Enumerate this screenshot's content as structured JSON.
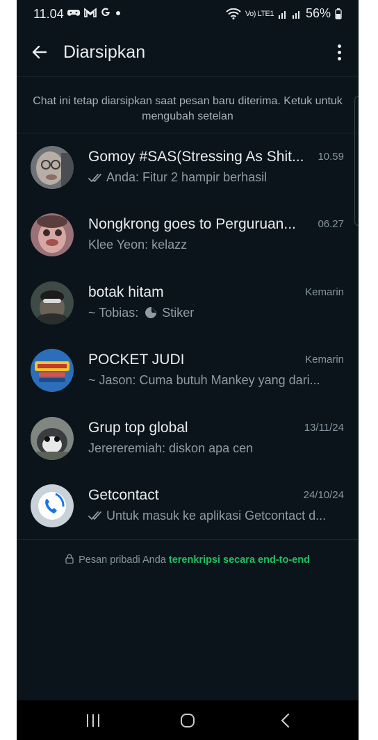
{
  "status_bar": {
    "time": "11.04",
    "notification_icons": [
      "game-controller-icon",
      "gmail-icon",
      "google-icon",
      "dot-icon"
    ],
    "network_label": "Vo) LTE1",
    "battery": "56%"
  },
  "header": {
    "title": "Diarsipkan",
    "back_icon": "arrow-left-icon",
    "menu_icon": "more-vertical-icon"
  },
  "info_text": "Chat ini tetap diarsipkan saat pesan baru diterima. Ketuk untuk mengubah setelan",
  "chats": [
    {
      "name": "Gomoy #SAS(Stressing As Shit...",
      "time": "10.59",
      "preview": "Anda: Fitur 2 hampir berhasil",
      "read_ticks": true,
      "avatar_color": "#7a8088"
    },
    {
      "name": "Nongkrong goes to Perguruan...",
      "time": "06.27",
      "preview": "Klee Yeon: kelazz",
      "read_ticks": false,
      "avatar_color": "#b9868a"
    },
    {
      "name": "botak hitam",
      "time": "Kemarin",
      "preview_prefix": "~ Tobias:",
      "preview": "Stiker",
      "sticker_icon": true,
      "read_ticks": false,
      "avatar_color": "#4a5550"
    },
    {
      "name": "POCKET JUDI",
      "time": "Kemarin",
      "preview": "~ Jason: Cuma butuh Mankey yang dari...",
      "read_ticks": false,
      "avatar_color": "#2d6eb5"
    },
    {
      "name": "Grup top global",
      "time": "13/11/24",
      "preview": "Jerereremiah: diskon apa cen",
      "read_ticks": false,
      "avatar_color": "#8a9089"
    },
    {
      "name": "Getcontact",
      "time": "24/10/24",
      "preview": "Untuk masuk ke aplikasi Getcontact d...",
      "read_ticks": true,
      "avatar_color": "#c7d0d6"
    }
  ],
  "footer": {
    "lock_icon": "lock-icon",
    "text_prefix": "Pesan pribadi Anda",
    "link_text": "terenkripsi secara end-to-end",
    "link_color": "#21c063"
  },
  "nav_bar": {
    "recents_icon": "recents-icon",
    "home_icon": "home-icon",
    "back_icon": "back-chevron-icon"
  }
}
